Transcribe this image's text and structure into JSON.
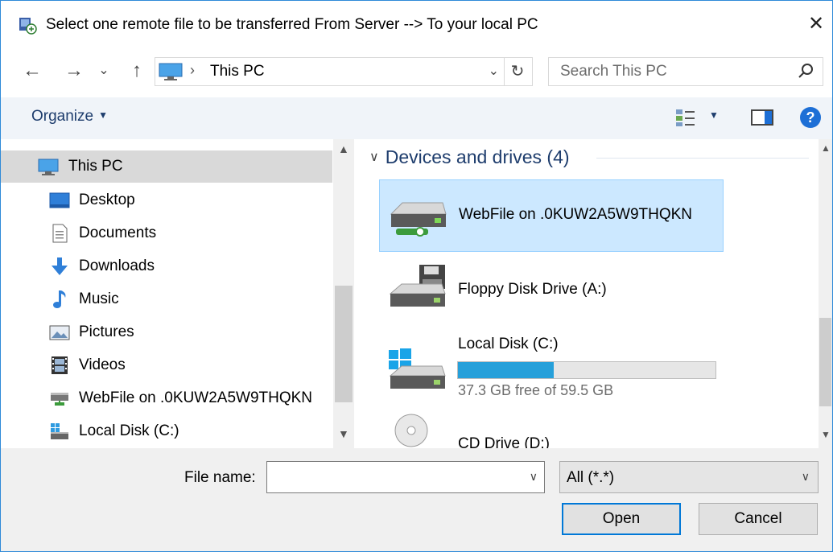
{
  "window": {
    "title": "Select one remote file to be transferred From Server --> To your local PC",
    "close_glyph": "✕"
  },
  "nav": {
    "back_glyph": "←",
    "forward_glyph": "→",
    "recent_glyph": "⌄",
    "up_glyph": "↑",
    "address_separator": "›",
    "address_path": "This PC",
    "refresh_glyph": "↻",
    "search_placeholder": "Search This PC"
  },
  "toolbar": {
    "organize_label": "Organize"
  },
  "sidebar": {
    "items": [
      {
        "label": "This PC",
        "icon": "pc-icon",
        "selected": true
      },
      {
        "label": "Desktop",
        "icon": "desktop-icon"
      },
      {
        "label": "Documents",
        "icon": "documents-icon"
      },
      {
        "label": "Downloads",
        "icon": "downloads-icon"
      },
      {
        "label": "Music",
        "icon": "music-icon"
      },
      {
        "label": "Pictures",
        "icon": "pictures-icon"
      },
      {
        "label": "Videos",
        "icon": "videos-icon"
      },
      {
        "label": "WebFile on .0KUW2A5W9THQKN",
        "icon": "network-drive-icon"
      },
      {
        "label": "Local Disk (C:)",
        "icon": "local-disk-icon"
      }
    ]
  },
  "content": {
    "group_header": "Devices and drives (4)",
    "drives": [
      {
        "name": "WebFile on .0KUW2A5W9THQKN",
        "icon": "network-drive-icon",
        "selected": true
      },
      {
        "name": "Floppy Disk Drive (A:)",
        "icon": "floppy-drive-icon"
      },
      {
        "name": "Local Disk (C:)",
        "icon": "windows-disk-icon",
        "free_text": "37.3 GB free of 59.5 GB",
        "used_fraction": 0.373
      },
      {
        "name": "CD Drive (D:)",
        "icon": "cd-drive-icon"
      }
    ]
  },
  "footer": {
    "filename_label": "File name:",
    "filename_value": "",
    "filter_value": "All (*.*)",
    "open_label": "Open",
    "cancel_label": "Cancel"
  },
  "colors": {
    "accent": "#0078d7",
    "selection": "#cce8ff",
    "header_text": "#1e3d6d",
    "disk_bar": "#26a0da"
  }
}
